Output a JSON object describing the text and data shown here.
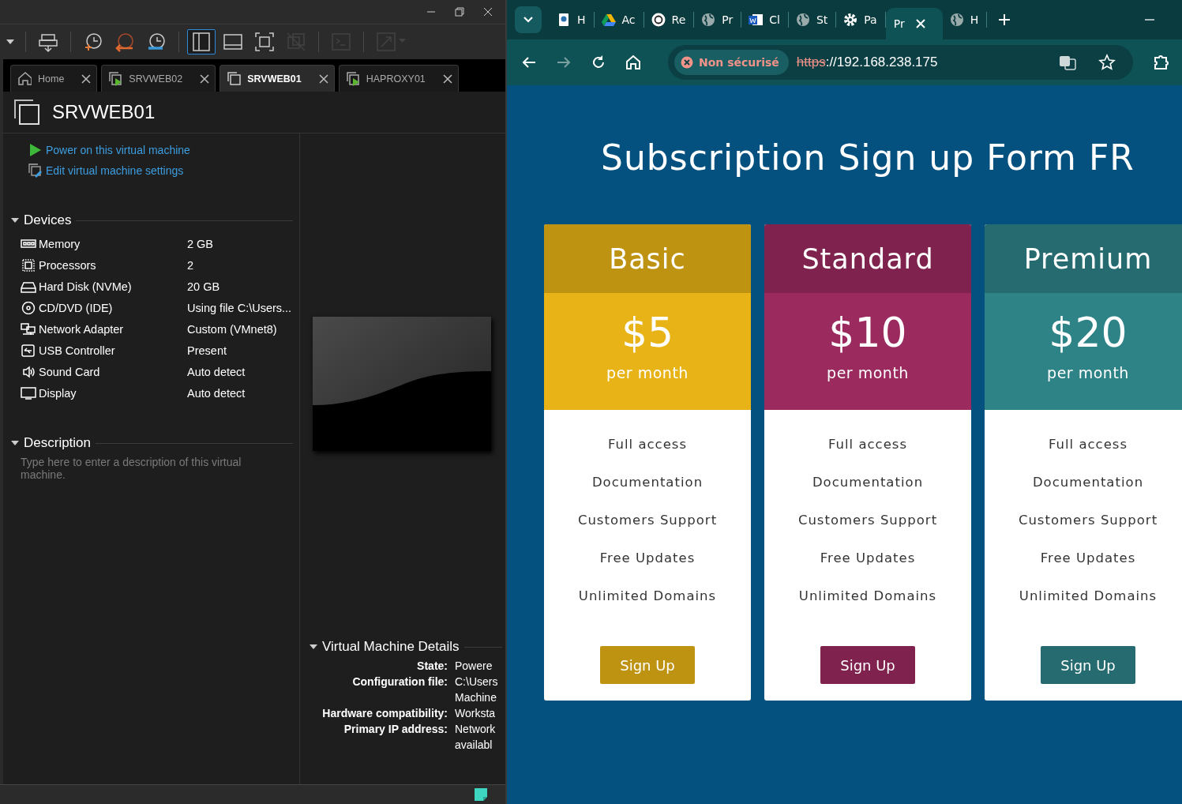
{
  "vmware": {
    "window_controls": [
      {
        "kind": "minimize"
      },
      {
        "kind": "restore"
      },
      {
        "kind": "close"
      }
    ],
    "toolbar": [
      {
        "kind": "dropdown",
        "selected": false,
        "disabled": false
      },
      {
        "kind": "send-keys",
        "selected": false,
        "disabled": false
      },
      {
        "kind": "snapshot-take",
        "selected": false,
        "disabled": false
      },
      {
        "kind": "snapshot-revert",
        "selected": false,
        "disabled": false
      },
      {
        "kind": "snapshot-manage",
        "selected": false,
        "disabled": false
      },
      {
        "kind": "library-view",
        "selected": true,
        "disabled": false
      },
      {
        "kind": "thumbnail-view",
        "selected": false,
        "disabled": false
      },
      {
        "kind": "full-screen",
        "selected": false,
        "disabled": false
      },
      {
        "kind": "unity",
        "selected": false,
        "disabled": true
      },
      {
        "kind": "console",
        "selected": false,
        "disabled": true
      },
      {
        "kind": "stretch",
        "selected": false,
        "disabled": true
      }
    ],
    "tabs": [
      {
        "kind": "home",
        "label": "Home",
        "selected": false
      },
      {
        "kind": "vm-running",
        "label": "SRVWEB02",
        "selected": false
      },
      {
        "kind": "vm",
        "label": "SRVWEB01",
        "selected": true
      },
      {
        "kind": "vm-running",
        "label": "HAPROXY01",
        "selected": false
      }
    ],
    "vm_name": "SRVWEB01",
    "actions": [
      {
        "kind": "power",
        "label": "Power on this virtual machine"
      },
      {
        "kind": "edit",
        "label": "Edit virtual machine settings"
      }
    ],
    "devices": {
      "title": "Devices",
      "expanded": true,
      "items": [
        {
          "kind": "memory",
          "name": "Memory",
          "value": "2 GB"
        },
        {
          "kind": "cpu",
          "name": "Processors",
          "value": "2"
        },
        {
          "kind": "disk",
          "name": "Hard Disk (NVMe)",
          "value": "20 GB"
        },
        {
          "kind": "cd",
          "name": "CD/DVD (IDE)",
          "value": "Using file C:\\Users..."
        },
        {
          "kind": "network",
          "name": "Network Adapter",
          "value": "Custom (VMnet8)"
        },
        {
          "kind": "usb",
          "name": "USB Controller",
          "value": "Present"
        },
        {
          "kind": "sound",
          "name": "Sound Card",
          "value": "Auto detect"
        },
        {
          "kind": "display",
          "name": "Display",
          "value": "Auto detect"
        }
      ]
    },
    "description": {
      "title": "Description",
      "expanded": true,
      "placeholder": "Type here to enter a description of this virtual machine."
    },
    "details": {
      "title": "Virtual Machine Details",
      "expanded": true,
      "rows": [
        {
          "label": "State:",
          "lines": [
            "Powere"
          ]
        },
        {
          "label": "Configuration file:",
          "lines": [
            "C:\\Users",
            "Machine"
          ]
        },
        {
          "label": "Hardware compatibility:",
          "lines": [
            "Worksta"
          ]
        },
        {
          "label": "Primary IP address:",
          "lines": [
            "Network",
            "availabl"
          ]
        }
      ]
    }
  },
  "browser": {
    "tabs": [
      {
        "kind": "app",
        "label": "H",
        "selected": false
      },
      {
        "kind": "drive",
        "label": "Ac",
        "selected": false
      },
      {
        "kind": "chat",
        "label": "Re",
        "selected": false
      },
      {
        "kind": "globe",
        "label": "Pr",
        "selected": false
      },
      {
        "kind": "word",
        "label": "Cl",
        "selected": false
      },
      {
        "kind": "globe",
        "label": "St",
        "selected": false
      },
      {
        "kind": "gear",
        "label": "Pa",
        "selected": false
      },
      {
        "kind": "none",
        "label": "Pr",
        "selected": true
      },
      {
        "kind": "globe",
        "label": "H",
        "selected": false
      }
    ],
    "nav": {
      "forward_disabled": true
    },
    "address": {
      "security": "Non sécurisé",
      "scheme": "https",
      "rest": "://192.168.238.175"
    },
    "page": {
      "title": "Subscription Sign up Form FR",
      "plans": [
        {
          "name": "Basic",
          "price": "$5",
          "period": "per month",
          "color": "#e8b316",
          "features": [
            "Full access",
            "Documentation",
            "Customers Support",
            "Free Updates",
            "Unlimited Domains"
          ],
          "button": "Sign Up"
        },
        {
          "name": "Standard",
          "price": "$10",
          "period": "per month",
          "color": "#9b2a5e",
          "features": [
            "Full access",
            "Documentation",
            "Customers Support",
            "Free Updates",
            "Unlimited Domains"
          ],
          "button": "Sign Up"
        },
        {
          "name": "Premium",
          "price": "$20",
          "period": "per month",
          "color": "#2e8387",
          "features": [
            "Full access",
            "Documentation",
            "Customers Support",
            "Free Updates",
            "Unlimited Domains"
          ],
          "button": "Sign Up"
        }
      ]
    }
  }
}
